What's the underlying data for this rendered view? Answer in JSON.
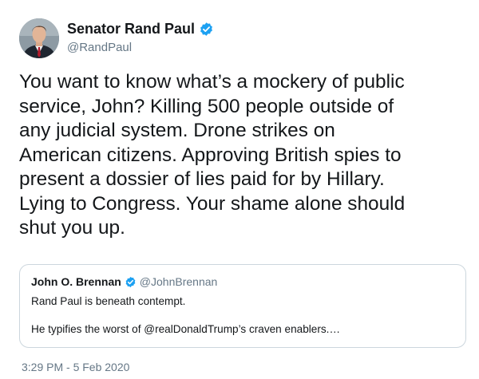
{
  "tweet": {
    "author": {
      "display_name": "Senator Rand Paul",
      "handle": "@RandPaul",
      "verified": true
    },
    "text_lines": [
      "You want to know what’s a mockery of public",
      "service, John? Killing 500 people outside of",
      "any judicial system. Drone strikes on",
      "American citizens. Approving British spies to",
      "present a dossier of lies paid for by Hillary.",
      "Lying to Congress. Your shame alone should",
      "shut you up."
    ],
    "timestamp": "3:29 PM - 5 Feb 2020"
  },
  "quoted_tweet": {
    "display_name": "John O. Brennan",
    "handle": "@JohnBrennan",
    "verified": true,
    "line1": "Rand Paul is beneath contempt.",
    "line2": "He typifies the worst of @realDonaldTrump’s craven enablers.…"
  },
  "colors": {
    "verified_badge": "#1da1f2",
    "secondary_text": "#657786",
    "primary_text": "#14171a",
    "border": "#ccd6dd"
  },
  "icons": {
    "verified": "verified-badge-icon"
  }
}
